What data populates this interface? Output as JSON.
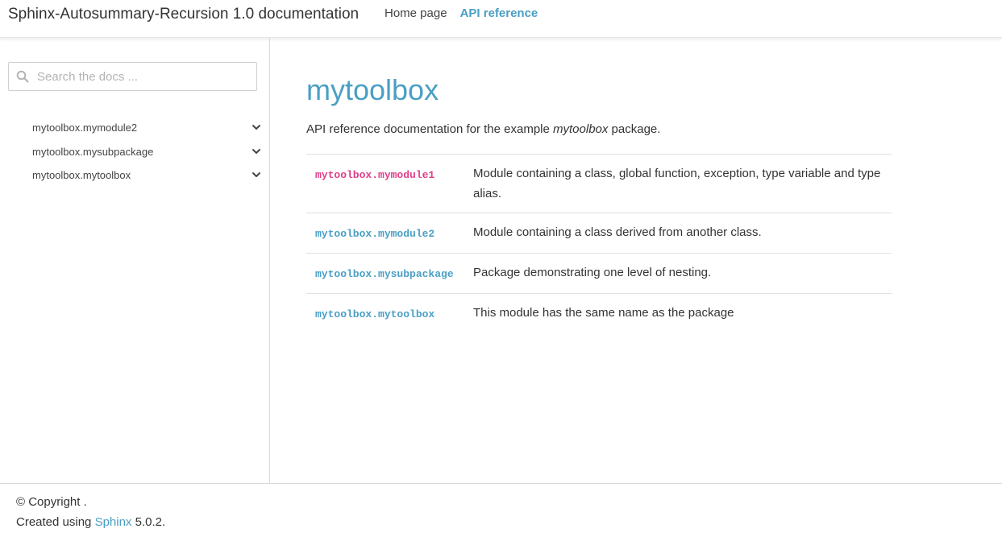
{
  "header": {
    "brand": "Sphinx-Autosummary-Recursion 1.0 documentation",
    "nav": [
      {
        "label": "Home page",
        "active": false
      },
      {
        "label": "API reference",
        "active": true
      }
    ],
    "accent_color": "#4a9fc4"
  },
  "sidebar": {
    "search": {
      "placeholder": "Search the docs ...",
      "value": "",
      "icon": "search-icon"
    },
    "toc": [
      {
        "label": "mytoolbox.mymodule2",
        "icon": "chevron-down-icon"
      },
      {
        "label": "mytoolbox.mysubpackage",
        "icon": "chevron-down-icon"
      },
      {
        "label": "mytoolbox.mytoolbox",
        "icon": "chevron-down-icon"
      }
    ]
  },
  "main": {
    "title": "mytoolbox",
    "intro_prefix": "API reference documentation for the example ",
    "intro_emphasis": "mytoolbox",
    "intro_suffix": " package.",
    "rows": [
      {
        "name": "mytoolbox.mymodule1",
        "description": "Module containing a class, global function, exception, type variable and type alias.",
        "current": true
      },
      {
        "name": "mytoolbox.mymodule2",
        "description": "Module containing a class derived from another class.",
        "current": false
      },
      {
        "name": "mytoolbox.mysubpackage",
        "description": "Package demonstrating one level of nesting.",
        "current": false
      },
      {
        "name": "mytoolbox.mytoolbox",
        "description": "This module has the same name as the package",
        "current": false
      }
    ],
    "current_link_color": "#e0408a"
  },
  "footer": {
    "copyright": "© Copyright .",
    "created_prefix": "Created using ",
    "created_link": "Sphinx",
    "created_suffix": " 5.0.2."
  }
}
